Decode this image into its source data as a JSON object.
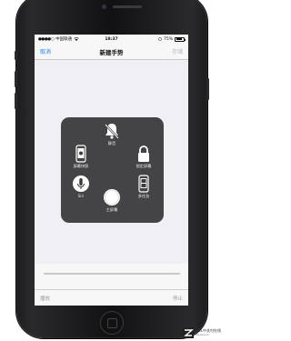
{
  "status_bar": {
    "carrier": "中国联通",
    "time": "18:37",
    "battery": "75%",
    "battery_level": 0.75
  },
  "nav": {
    "cancel_label": "取消",
    "title": "新建手势",
    "save_label": "存储"
  },
  "assistive_touch": {
    "items": [
      {
        "label": "静音",
        "icon": "mute-bell-icon"
      },
      {
        "label": "屏幕快照",
        "icon": "screenshot-phone-icon"
      },
      {
        "label": "锁定屏幕",
        "icon": "lock-icon"
      },
      {
        "label": "Siri",
        "icon": "siri-microphone-icon"
      },
      {
        "label": "主屏幕",
        "icon": "home-circle-icon"
      },
      {
        "label": "多任务",
        "icon": "multitask-phone-icon"
      }
    ]
  },
  "playback": {
    "progress": 0.0,
    "play_label": "播放",
    "stop_label": "停止"
  },
  "watermark": {
    "site": "ZOL中关村在线",
    "url": "zol.com.cn"
  },
  "colors": {
    "accent": "#1a7ffb",
    "panel": "#3a3a3c"
  }
}
